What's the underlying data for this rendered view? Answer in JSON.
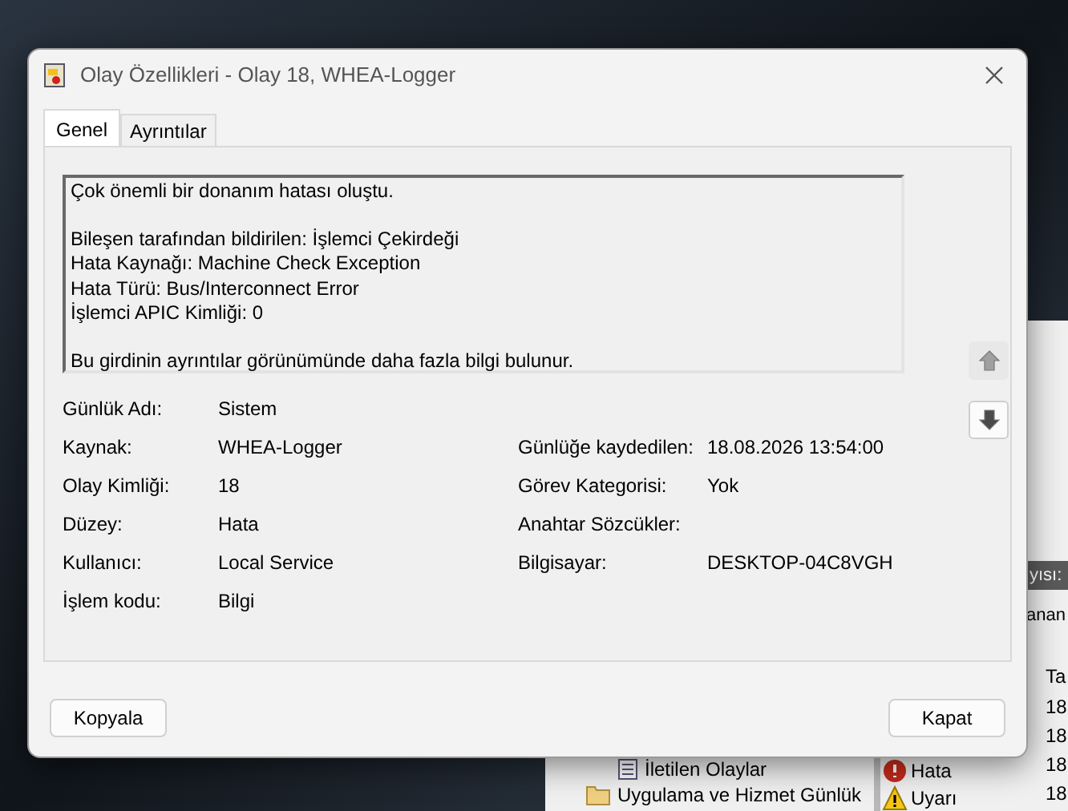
{
  "background_window": {
    "tree_items": [
      {
        "label": "İletilen Olaylar",
        "kind": "log"
      },
      {
        "label": "Uygulama ve Hizmet Günlük",
        "kind": "folder"
      }
    ],
    "bar_text": "yısı:",
    "sub_text": "anan",
    "column_1": "Ta",
    "levels": [
      {
        "kind": "error",
        "label": "Hata"
      },
      {
        "kind": "warning",
        "label": "Uyarı"
      }
    ],
    "dates": [
      "18",
      "18",
      "18",
      "18"
    ]
  },
  "dialog": {
    "title": "Olay Özellikleri - Olay 18, WHEA-Logger",
    "tabs": [
      {
        "label": "Genel",
        "selected": true
      },
      {
        "label": "Ayrıntılar",
        "selected": false
      }
    ],
    "description": [
      [
        "Çok önemli bir donanım hatası oluştu."
      ],
      [
        "Bileşen tarafından bildirilen: İşlemci Çekirdeği",
        "Hata Kaynağı: Machine Check Exception",
        "Hata Türü: Bus/Interconnect Error",
        "İşlemci APIC Kimliği: 0"
      ],
      [
        "Bu girdinin ayrıntılar görünümünde daha fazla bilgi bulunur."
      ]
    ],
    "nav_buttons": [
      {
        "kind": "up",
        "disabled": true
      },
      {
        "kind": "down",
        "disabled": false
      }
    ],
    "fields": [
      {
        "left": {
          "label": "Günlük Adı:",
          "value": "Sistem"
        }
      },
      {
        "left": {
          "label": "Kaynak:",
          "value": "WHEA-Logger"
        },
        "right": {
          "label": "Günlüğe kaydedilen:",
          "value": "18.08.2026 13:54:00"
        }
      },
      {
        "left": {
          "label": "Olay Kimliği:",
          "value": "18"
        },
        "right": {
          "label": "Görev Kategorisi:",
          "value": "Yok"
        }
      },
      {
        "left": {
          "label": "Düzey:",
          "value": "Hata"
        },
        "right": {
          "label": "Anahtar Sözcükler:"
        }
      },
      {
        "left": {
          "label": "Kullanıcı:",
          "value": "Local Service"
        },
        "right": {
          "label": "Bilgisayar:",
          "value": "DESKTOP-04C8VGH"
        }
      },
      {
        "left": {
          "label": "İşlem kodu:",
          "value": "Bilgi"
        }
      }
    ],
    "buttons": [
      {
        "label": "Kopyala"
      },
      {
        "label": "Kapat"
      }
    ]
  }
}
